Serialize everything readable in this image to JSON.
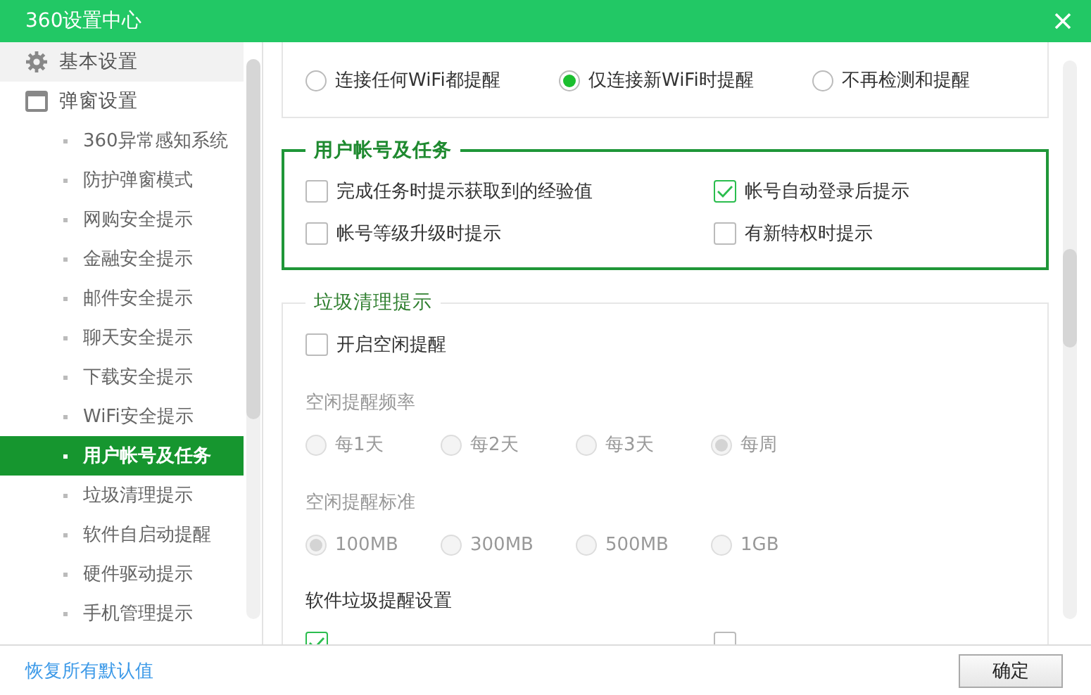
{
  "window": {
    "title": "360设置中心"
  },
  "sidebar": {
    "sections": [
      {
        "label": "基本设置",
        "hovered": true
      },
      {
        "label": "弹窗设置",
        "hovered": false,
        "children": [
          {
            "label": "360异常感知系统",
            "selected": false
          },
          {
            "label": "防护弹窗模式",
            "selected": false
          },
          {
            "label": "网购安全提示",
            "selected": false
          },
          {
            "label": "金融安全提示",
            "selected": false
          },
          {
            "label": "邮件安全提示",
            "selected": false
          },
          {
            "label": "聊天安全提示",
            "selected": false
          },
          {
            "label": "下载安全提示",
            "selected": false
          },
          {
            "label": "WiFi安全提示",
            "selected": false
          },
          {
            "label": "用户帐号及任务",
            "selected": true
          },
          {
            "label": "垃圾清理提示",
            "selected": false
          },
          {
            "label": "软件自启动提醒",
            "selected": false
          },
          {
            "label": "硬件驱动提示",
            "selected": false
          },
          {
            "label": "手机管理提示",
            "selected": false
          }
        ]
      }
    ]
  },
  "content": {
    "groups": [
      {
        "highlighted": false,
        "items": [
          {
            "kind": "radio_grid",
            "disabled": false,
            "options": [
              {
                "label": "连接任何WiFi都提醒",
                "selected": false
              },
              {
                "label": "仅连接新WiFi时提醒",
                "selected": true
              },
              {
                "label": "不再检测和提醒",
                "selected": false
              }
            ]
          }
        ]
      },
      {
        "title": "用户帐号及任务",
        "highlighted": true,
        "items": [
          {
            "kind": "checkbox_grid",
            "options": [
              {
                "label": "完成任务时提示获取到的经验值",
                "checked": false
              },
              {
                "label": "帐号自动登录后提示",
                "checked": true
              },
              {
                "label": "帐号等级升级时提示",
                "checked": false
              },
              {
                "label": "有新特权时提示",
                "checked": false
              }
            ]
          }
        ]
      },
      {
        "title": "垃圾清理提示",
        "highlighted": false,
        "items": [
          {
            "kind": "checkbox_grid",
            "options": [
              {
                "label": "开启空闲提醒",
                "checked": false
              }
            ]
          },
          {
            "kind": "caption",
            "text": "空闲提醒频率"
          },
          {
            "kind": "radio_grid",
            "disabled": true,
            "options": [
              {
                "label": "每1天",
                "selected": false
              },
              {
                "label": "每2天",
                "selected": false
              },
              {
                "label": "每3天",
                "selected": false
              },
              {
                "label": "每周",
                "selected": true
              }
            ]
          },
          {
            "kind": "caption",
            "text": "空闲提醒标准"
          },
          {
            "kind": "radio_grid",
            "disabled": true,
            "options": [
              {
                "label": "100MB",
                "selected": true
              },
              {
                "label": "300MB",
                "selected": false
              },
              {
                "label": "500MB",
                "selected": false
              },
              {
                "label": "1GB",
                "selected": false
              }
            ]
          },
          {
            "kind": "subheading",
            "text": "软件垃圾提醒设置"
          },
          {
            "kind": "checkbox_grid",
            "options": [
              {
                "checked": true
              },
              {
                "checked": false
              }
            ]
          }
        ]
      }
    ]
  },
  "footer": {
    "reset_link": "恢复所有默认值",
    "ok_button": "确定"
  }
}
